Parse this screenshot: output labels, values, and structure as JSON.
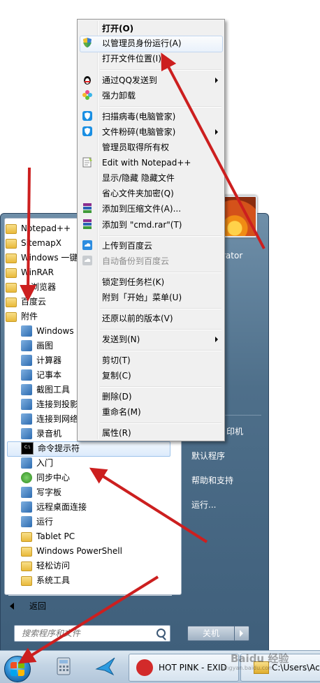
{
  "context_menu": {
    "items": [
      {
        "label": "打开(O)"
      },
      {
        "label": "以管理员身份运行(A)"
      },
      {
        "label": "打开文件位置(I)"
      },
      {
        "label": "通过QQ发送到"
      },
      {
        "label": "强力卸载"
      },
      {
        "label": "扫描病毒(电脑管家)"
      },
      {
        "label": "文件粉碎(电脑管家)"
      },
      {
        "label": "管理员取得所有权"
      },
      {
        "label": "Edit with Notepad++"
      },
      {
        "label": "显示/隐藏 隐藏文件"
      },
      {
        "label": "省心文件夹加密(Q)"
      },
      {
        "label": "添加到压缩文件(A)..."
      },
      {
        "label": "添加到 \"cmd.rar\"(T)"
      },
      {
        "label": "上传到百度云"
      },
      {
        "label": "自动备份到百度云"
      },
      {
        "label": "锁定到任务栏(K)"
      },
      {
        "label": "附到「开始」菜单(U)"
      },
      {
        "label": "还原以前的版本(V)"
      },
      {
        "label": "发送到(N)"
      },
      {
        "label": "剪切(T)"
      },
      {
        "label": "复制(C)"
      },
      {
        "label": "删除(D)"
      },
      {
        "label": "重命名(M)"
      },
      {
        "label": "属性(R)"
      }
    ]
  },
  "start_menu": {
    "programs": [
      {
        "label": "Notepad++"
      },
      {
        "label": "SitemapX"
      },
      {
        "label": "Windows 一键"
      },
      {
        "label": "WinRAR"
      },
      {
        "label": "浏览器"
      },
      {
        "label": "百度云"
      },
      {
        "label": "附件"
      },
      {
        "label": "Windows"
      },
      {
        "label": "画图"
      },
      {
        "label": "计算器"
      },
      {
        "label": "记事本"
      },
      {
        "label": "截图工具"
      },
      {
        "label": "连接到投影"
      },
      {
        "label": "连接到网络"
      },
      {
        "label": "录音机"
      },
      {
        "label": "命令提示符"
      },
      {
        "label": "入门"
      },
      {
        "label": "同步中心"
      },
      {
        "label": "写字板"
      },
      {
        "label": "远程桌面连接"
      },
      {
        "label": "运行"
      },
      {
        "label": "Tablet PC"
      },
      {
        "label": "Windows PowerShell"
      },
      {
        "label": "轻松访问"
      },
      {
        "label": "系统工具"
      }
    ],
    "back_label": "返回",
    "search_placeholder": "搜索程序和文件",
    "right_pane": {
      "username": "rator",
      "items": [
        {
          "label": "印机"
        },
        {
          "label": "默认程序"
        },
        {
          "label": "帮助和支持"
        },
        {
          "label": "运行..."
        }
      ],
      "shutdown_label": "关机"
    }
  },
  "taskbar": {
    "music_label": "HOT PINK - EXID",
    "explorer_label": "C:\\Users\\Ac",
    "watermark": "Baidu 经验",
    "watermark_sub": "jingyan.baidu.com"
  },
  "colors": {
    "annotation_arrow": "#cc1f1f",
    "highlight": "#dcebfc"
  }
}
